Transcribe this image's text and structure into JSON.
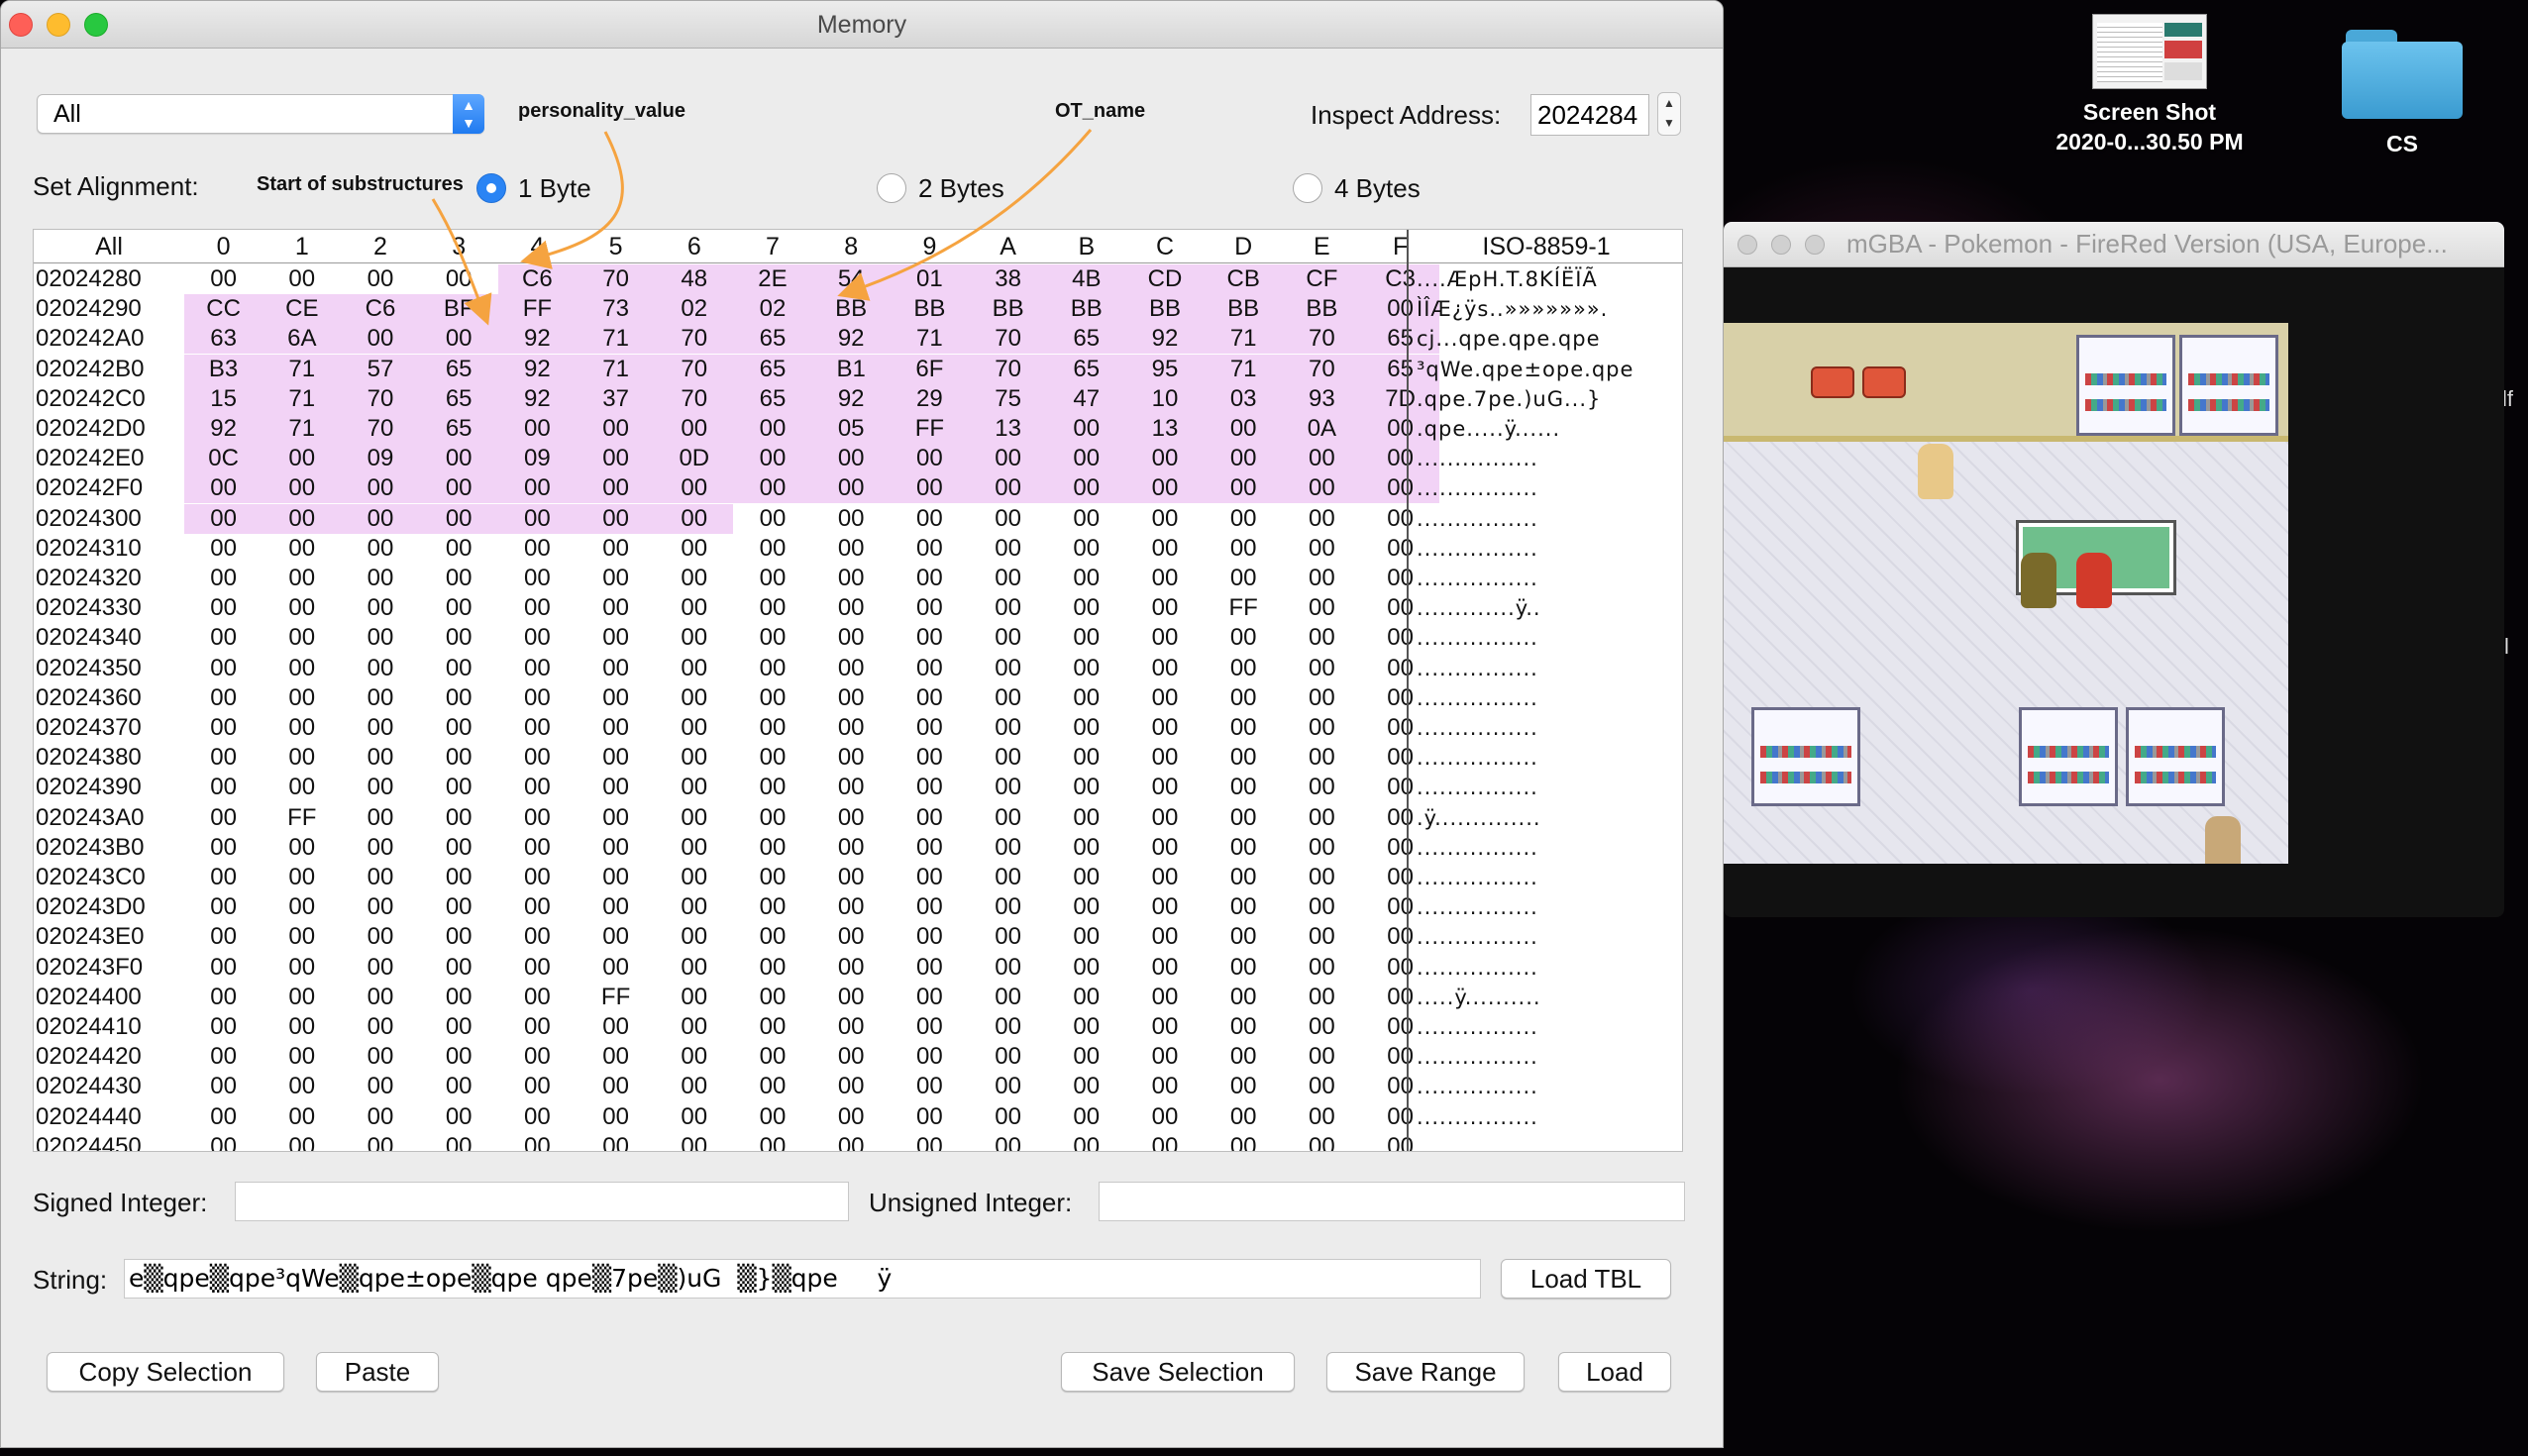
{
  "window": {
    "title": "Memory"
  },
  "controls": {
    "region_value": "All",
    "inspect_label": "Inspect Address:",
    "inspect_value": "2024284",
    "alignment_label": "Set Alignment:",
    "alignment_options": [
      "1 Byte",
      "2 Bytes",
      "4 Bytes"
    ],
    "alignment_selected": "1 Byte"
  },
  "annotations": {
    "personality": "personality_value",
    "ot_name": "OT_name",
    "substructures": "Start of substructures",
    "arrow_color": "#f5a340"
  },
  "hex": {
    "corner": "All",
    "columns": [
      "0",
      "1",
      "2",
      "3",
      "4",
      "5",
      "6",
      "7",
      "8",
      "9",
      "A",
      "B",
      "C",
      "D",
      "E",
      "F"
    ],
    "ascii_header": "ISO-8859-1",
    "selection_color": "#f2d3f6",
    "rows": [
      {
        "addr": "02024280",
        "bytes": [
          "00",
          "00",
          "00",
          "00",
          "C6",
          "70",
          "48",
          "2E",
          "54",
          "01",
          "38",
          "4B",
          "CD",
          "CB",
          "CF",
          "C3"
        ],
        "ascii": "....ÆpH.T.8KÍËÏÃ"
      },
      {
        "addr": "02024290",
        "bytes": [
          "CC",
          "CE",
          "C6",
          "BF",
          "FF",
          "73",
          "02",
          "02",
          "BB",
          "BB",
          "BB",
          "BB",
          "BB",
          "BB",
          "BB",
          "00"
        ],
        "ascii": "ÌÎÆ¿ÿs..»»»»»»»."
      },
      {
        "addr": "020242A0",
        "bytes": [
          "63",
          "6A",
          "00",
          "00",
          "92",
          "71",
          "70",
          "65",
          "92",
          "71",
          "70",
          "65",
          "92",
          "71",
          "70",
          "65"
        ],
        "ascii": "cj...qpe.qpe.qpe"
      },
      {
        "addr": "020242B0",
        "bytes": [
          "B3",
          "71",
          "57",
          "65",
          "92",
          "71",
          "70",
          "65",
          "B1",
          "6F",
          "70",
          "65",
          "95",
          "71",
          "70",
          "65"
        ],
        "ascii": "³qWe.qpe±ope.qpe"
      },
      {
        "addr": "020242C0",
        "bytes": [
          "15",
          "71",
          "70",
          "65",
          "92",
          "37",
          "70",
          "65",
          "92",
          "29",
          "75",
          "47",
          "10",
          "03",
          "93",
          "7D"
        ],
        "ascii": ".qpe.7pe.)uG...}"
      },
      {
        "addr": "020242D0",
        "bytes": [
          "92",
          "71",
          "70",
          "65",
          "00",
          "00",
          "00",
          "00",
          "05",
          "FF",
          "13",
          "00",
          "13",
          "00",
          "0A",
          "00"
        ],
        "ascii": ".qpe.....ÿ......"
      },
      {
        "addr": "020242E0",
        "bytes": [
          "0C",
          "00",
          "09",
          "00",
          "09",
          "00",
          "0D",
          "00",
          "00",
          "00",
          "00",
          "00",
          "00",
          "00",
          "00",
          "00"
        ],
        "ascii": "................"
      },
      {
        "addr": "020242F0",
        "bytes": [
          "00",
          "00",
          "00",
          "00",
          "00",
          "00",
          "00",
          "00",
          "00",
          "00",
          "00",
          "00",
          "00",
          "00",
          "00",
          "00"
        ],
        "ascii": "................"
      },
      {
        "addr": "02024300",
        "bytes": [
          "00",
          "00",
          "00",
          "00",
          "00",
          "00",
          "00",
          "00",
          "00",
          "00",
          "00",
          "00",
          "00",
          "00",
          "00",
          "00"
        ],
        "ascii": "................"
      },
      {
        "addr": "02024310",
        "bytes": [
          "00",
          "00",
          "00",
          "00",
          "00",
          "00",
          "00",
          "00",
          "00",
          "00",
          "00",
          "00",
          "00",
          "00",
          "00",
          "00"
        ],
        "ascii": "................"
      },
      {
        "addr": "02024320",
        "bytes": [
          "00",
          "00",
          "00",
          "00",
          "00",
          "00",
          "00",
          "00",
          "00",
          "00",
          "00",
          "00",
          "00",
          "00",
          "00",
          "00"
        ],
        "ascii": "................"
      },
      {
        "addr": "02024330",
        "bytes": [
          "00",
          "00",
          "00",
          "00",
          "00",
          "00",
          "00",
          "00",
          "00",
          "00",
          "00",
          "00",
          "00",
          "FF",
          "00",
          "00"
        ],
        "ascii": ".............ÿ.."
      },
      {
        "addr": "02024340",
        "bytes": [
          "00",
          "00",
          "00",
          "00",
          "00",
          "00",
          "00",
          "00",
          "00",
          "00",
          "00",
          "00",
          "00",
          "00",
          "00",
          "00"
        ],
        "ascii": "................"
      },
      {
        "addr": "02024350",
        "bytes": [
          "00",
          "00",
          "00",
          "00",
          "00",
          "00",
          "00",
          "00",
          "00",
          "00",
          "00",
          "00",
          "00",
          "00",
          "00",
          "00"
        ],
        "ascii": "................"
      },
      {
        "addr": "02024360",
        "bytes": [
          "00",
          "00",
          "00",
          "00",
          "00",
          "00",
          "00",
          "00",
          "00",
          "00",
          "00",
          "00",
          "00",
          "00",
          "00",
          "00"
        ],
        "ascii": "................"
      },
      {
        "addr": "02024370",
        "bytes": [
          "00",
          "00",
          "00",
          "00",
          "00",
          "00",
          "00",
          "00",
          "00",
          "00",
          "00",
          "00",
          "00",
          "00",
          "00",
          "00"
        ],
        "ascii": "................"
      },
      {
        "addr": "02024380",
        "bytes": [
          "00",
          "00",
          "00",
          "00",
          "00",
          "00",
          "00",
          "00",
          "00",
          "00",
          "00",
          "00",
          "00",
          "00",
          "00",
          "00"
        ],
        "ascii": "................"
      },
      {
        "addr": "02024390",
        "bytes": [
          "00",
          "00",
          "00",
          "00",
          "00",
          "00",
          "00",
          "00",
          "00",
          "00",
          "00",
          "00",
          "00",
          "00",
          "00",
          "00"
        ],
        "ascii": "................"
      },
      {
        "addr": "020243A0",
        "bytes": [
          "00",
          "FF",
          "00",
          "00",
          "00",
          "00",
          "00",
          "00",
          "00",
          "00",
          "00",
          "00",
          "00",
          "00",
          "00",
          "00"
        ],
        "ascii": ".ÿ.............."
      },
      {
        "addr": "020243B0",
        "bytes": [
          "00",
          "00",
          "00",
          "00",
          "00",
          "00",
          "00",
          "00",
          "00",
          "00",
          "00",
          "00",
          "00",
          "00",
          "00",
          "00"
        ],
        "ascii": "................"
      },
      {
        "addr": "020243C0",
        "bytes": [
          "00",
          "00",
          "00",
          "00",
          "00",
          "00",
          "00",
          "00",
          "00",
          "00",
          "00",
          "00",
          "00",
          "00",
          "00",
          "00"
        ],
        "ascii": "................"
      },
      {
        "addr": "020243D0",
        "bytes": [
          "00",
          "00",
          "00",
          "00",
          "00",
          "00",
          "00",
          "00",
          "00",
          "00",
          "00",
          "00",
          "00",
          "00",
          "00",
          "00"
        ],
        "ascii": "................"
      },
      {
        "addr": "020243E0",
        "bytes": [
          "00",
          "00",
          "00",
          "00",
          "00",
          "00",
          "00",
          "00",
          "00",
          "00",
          "00",
          "00",
          "00",
          "00",
          "00",
          "00"
        ],
        "ascii": "................"
      },
      {
        "addr": "020243F0",
        "bytes": [
          "00",
          "00",
          "00",
          "00",
          "00",
          "00",
          "00",
          "00",
          "00",
          "00",
          "00",
          "00",
          "00",
          "00",
          "00",
          "00"
        ],
        "ascii": "................"
      },
      {
        "addr": "02024400",
        "bytes": [
          "00",
          "00",
          "00",
          "00",
          "00",
          "FF",
          "00",
          "00",
          "00",
          "00",
          "00",
          "00",
          "00",
          "00",
          "00",
          "00"
        ],
        "ascii": ".....ÿ.........."
      },
      {
        "addr": "02024410",
        "bytes": [
          "00",
          "00",
          "00",
          "00",
          "00",
          "00",
          "00",
          "00",
          "00",
          "00",
          "00",
          "00",
          "00",
          "00",
          "00",
          "00"
        ],
        "ascii": "................"
      },
      {
        "addr": "02024420",
        "bytes": [
          "00",
          "00",
          "00",
          "00",
          "00",
          "00",
          "00",
          "00",
          "00",
          "00",
          "00",
          "00",
          "00",
          "00",
          "00",
          "00"
        ],
        "ascii": "................"
      },
      {
        "addr": "02024430",
        "bytes": [
          "00",
          "00",
          "00",
          "00",
          "00",
          "00",
          "00",
          "00",
          "00",
          "00",
          "00",
          "00",
          "00",
          "00",
          "00",
          "00"
        ],
        "ascii": "................"
      },
      {
        "addr": "02024440",
        "bytes": [
          "00",
          "00",
          "00",
          "00",
          "00",
          "00",
          "00",
          "00",
          "00",
          "00",
          "00",
          "00",
          "00",
          "00",
          "00",
          "00"
        ],
        "ascii": "................"
      },
      {
        "addr": "02024450",
        "bytes": [
          "00",
          "00",
          "00",
          "00",
          "00",
          "00",
          "00",
          "00",
          "00",
          "00",
          "00",
          "00",
          "00",
          "00",
          "00",
          "00"
        ],
        "ascii": "................"
      }
    ]
  },
  "fields": {
    "signed_label": "Signed Integer:",
    "signed_value": "",
    "unsigned_label": "Unsigned Integer:",
    "unsigned_value": "",
    "string_label": "String:",
    "string_value": "e▒qpe▒qpe³qWe▒qpe±ope▒qpe qpe▒7pe▒)uG  ▒}▒qpe     ÿ"
  },
  "buttons": {
    "load_tbl": "Load TBL",
    "copy_selection": "Copy Selection",
    "paste": "Paste",
    "save_selection": "Save Selection",
    "save_range": "Save Range",
    "load": "Load"
  },
  "desktop": {
    "screenshot_label_line1": "Screen Shot",
    "screenshot_label_line2": "2020-0...30.50 PM",
    "folder_label": "CS",
    "right_edge_glyph1": "lf",
    "right_edge_glyph2": "l"
  },
  "mgba": {
    "title": "mGBA - Pokemon - FireRed Version (USA, Europe..."
  }
}
